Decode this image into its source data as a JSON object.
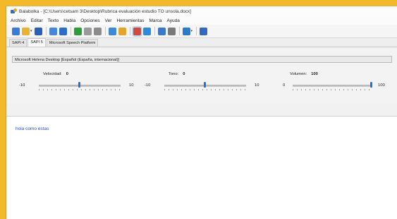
{
  "window": {
    "title": "Balabolka - [C:\\Users\\cetsam 3\\Desktop\\Rubrica evaluación estudio TO unsola.docx]"
  },
  "menu": [
    "Archivo",
    "Editar",
    "Texto",
    "Habla",
    "Opciones",
    "Ver",
    "Herramientas",
    "Marca",
    "Ayuda"
  ],
  "toolbar": {
    "icons": [
      "new-file-icon",
      "open-folder-icon",
      "save-icon",
      "copy-icon",
      "paste-icon",
      "play-icon",
      "pause-icon",
      "stop-icon",
      "dictionary-icon",
      "convert-icon",
      "language-icon",
      "table-icon",
      "settings-icon",
      "clock-icon",
      "globe-icon",
      "help-icon"
    ],
    "colors": {
      "blue": "#2b6fd1",
      "green": "#2e9c3a",
      "gray": "#8c8c8c",
      "yellow": "#e9b233",
      "red": "#d14a3a",
      "purple": "#6b4bbf"
    }
  },
  "tabs": [
    "SAPI 4",
    "SAPI 5",
    "Microsoft Speech Platform"
  ],
  "active_tab": 1,
  "voice": {
    "selected": "Microsoft Helena Desktop [Español (España, internacional)]"
  },
  "sliders": {
    "rate": {
      "label": "Velocidad:",
      "value": "0",
      "min": "-10",
      "max": "10",
      "level": 0.5
    },
    "pitch": {
      "label": "Tono:",
      "value": "0",
      "min": "-10",
      "max": "10",
      "level": 0.5
    },
    "volume": {
      "label": "Volumen:",
      "value": "100",
      "min": "0",
      "max": "100",
      "level": 1.0
    }
  },
  "editor": {
    "text": "hola como estas"
  }
}
